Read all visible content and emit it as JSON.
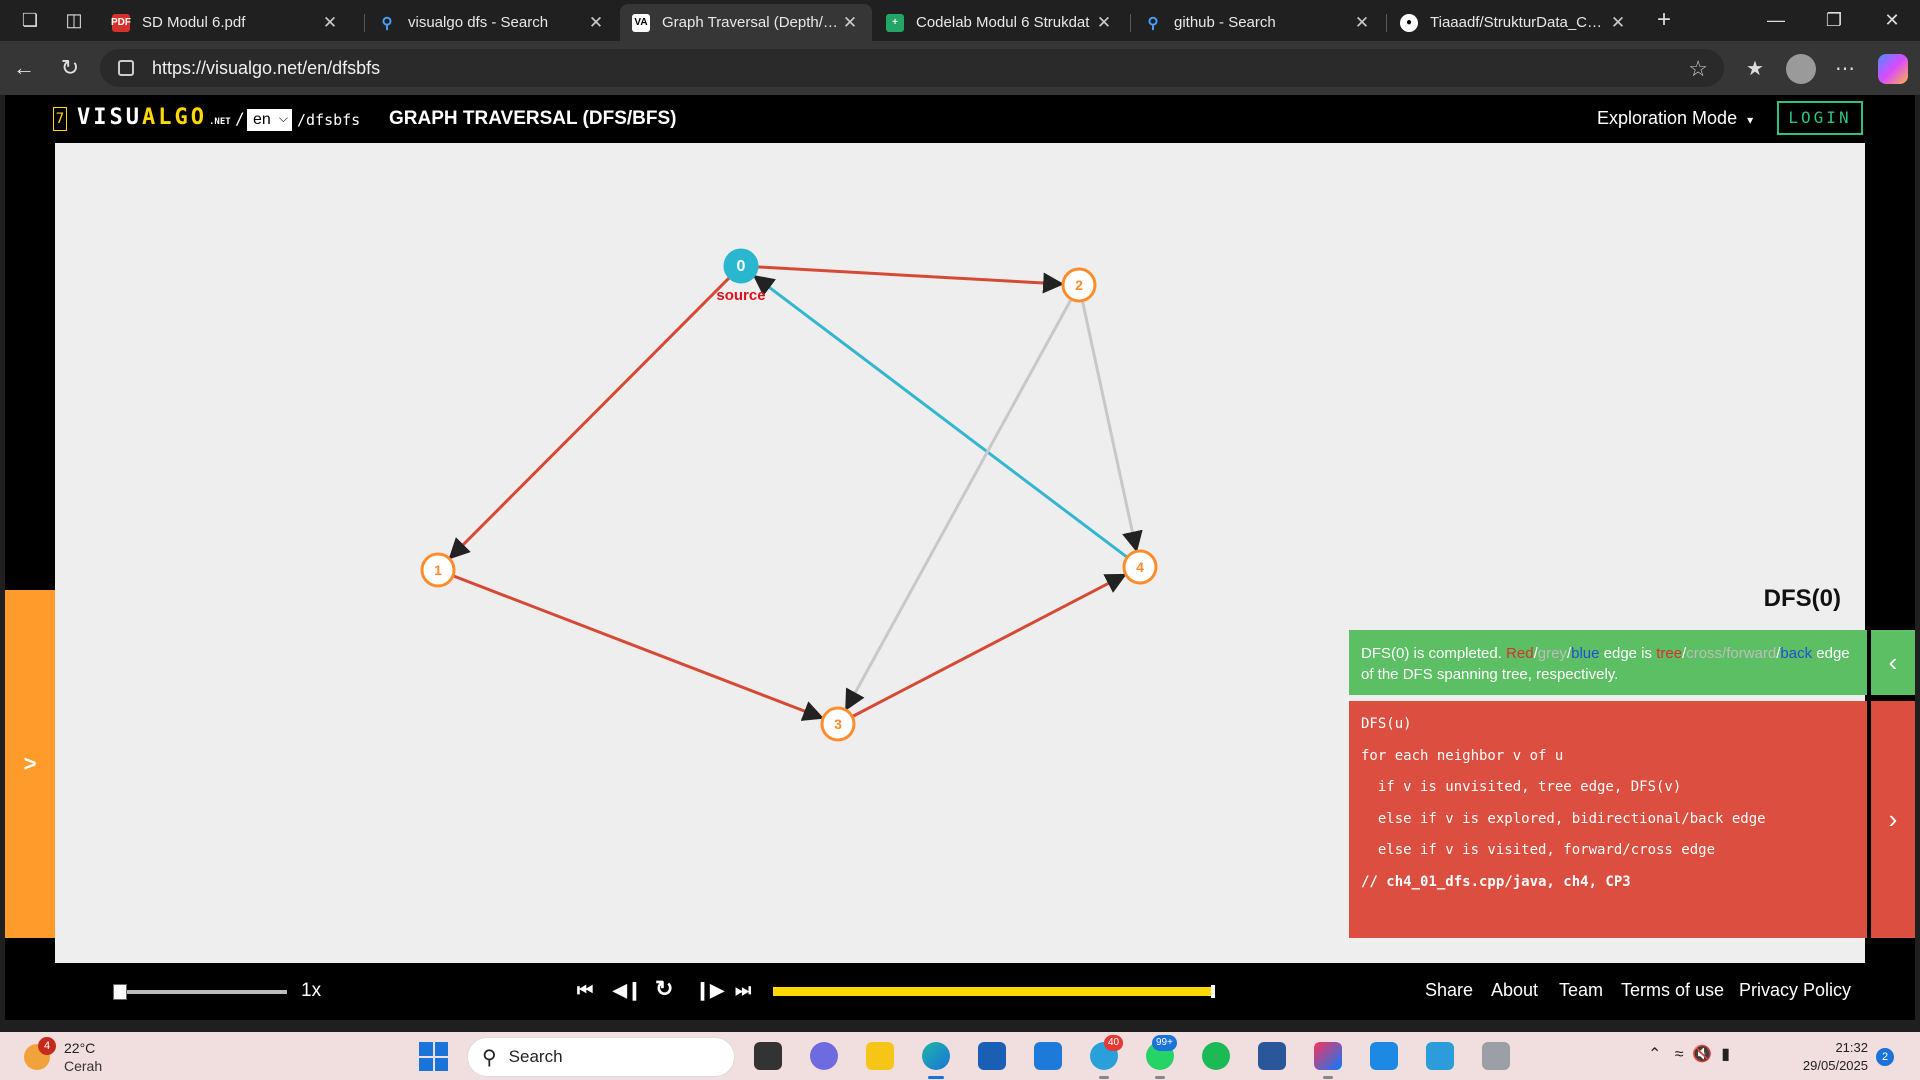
{
  "browser": {
    "tabs": [
      {
        "title": "SD Modul 6.pdf",
        "favicon": "pdf-icon"
      },
      {
        "title": "visualgo dfs - Search",
        "favicon": "search-icon"
      },
      {
        "title": "Graph Traversal (Depth/Bre",
        "favicon": "visualgo-icon"
      },
      {
        "title": "Codelab Modul 6 Strukdat",
        "favicon": "sheets-icon"
      },
      {
        "title": "github - Search",
        "favicon": "search-icon"
      },
      {
        "title": "Tiaaadf/StrukturData_Code",
        "favicon": "github-icon"
      }
    ],
    "active_tab": 2,
    "url": "https://visualgo.net/en/dfsbfs"
  },
  "header": {
    "logo_seven": "7",
    "logo_a": "VISU",
    "logo_b": "ALGO",
    "logo_net": ".NET",
    "logo_slash": "/",
    "lang": "en",
    "path": "/dfsbfs",
    "title": "GRAPH TRAVERSAL (DFS/BFS)",
    "mode": "Exploration Mode",
    "login": "LOGIN"
  },
  "graph": {
    "nodes": [
      {
        "id": "0",
        "state": "source"
      },
      {
        "id": "2",
        "state": "visited"
      },
      {
        "id": "1",
        "state": "visited"
      },
      {
        "id": "3",
        "state": "visited"
      },
      {
        "id": "4",
        "state": "visited"
      }
    ],
    "edges": [
      {
        "from": "0",
        "to": "2",
        "type": "tree"
      },
      {
        "from": "0",
        "to": "1",
        "type": "tree"
      },
      {
        "from": "1",
        "to": "3",
        "type": "tree"
      },
      {
        "from": "3",
        "to": "4",
        "type": "tree"
      },
      {
        "from": "4",
        "to": "0",
        "type": "back"
      },
      {
        "from": "2",
        "to": "3",
        "type": "cross"
      },
      {
        "from": "2",
        "to": "4",
        "type": "cross"
      }
    ],
    "source_label": "source",
    "colors": {
      "tree": "#d64a35",
      "cross": "#c8c8c8",
      "back": "#33b6cf",
      "node": "#ff8c2a",
      "source": "#29b7cf"
    }
  },
  "dfs_label": "DFS(0)",
  "status": {
    "prefix": "DFS(0) is completed. ",
    "red": "Red",
    "slash1": "/",
    "grey": "grey",
    "slash2": "/",
    "blue": "blue",
    "middle": " edge is ",
    "tree": "tree",
    "slash3": "/",
    "cross": "cross/forward",
    "slash4": "/",
    "back": "back",
    "suffix": " edge of the DFS spanning tree, respectively."
  },
  "code_lines": [
    "DFS(u)",
    "for each neighbor v of u",
    "  if v is unvisited, tree edge, DFS(v)",
    "  else if v is explored, bidirectional/back edge",
    "  else if v is visited, forward/cross edge",
    "// ch4_01_dfs.cpp/java, ch4, CP3"
  ],
  "controls": {
    "speed": "1x",
    "progress": 1.0,
    "links": [
      "Share",
      "About",
      "Team",
      "Terms of use",
      "Privacy Policy"
    ]
  },
  "taskbar": {
    "weather_badge": "4",
    "temperature": "22°C",
    "condition": "Cerah",
    "search": "Search",
    "telegram_badge": "40",
    "whatsapp_badge": "99+",
    "time": "21:32",
    "date": "29/05/2025",
    "notifications": "2"
  }
}
